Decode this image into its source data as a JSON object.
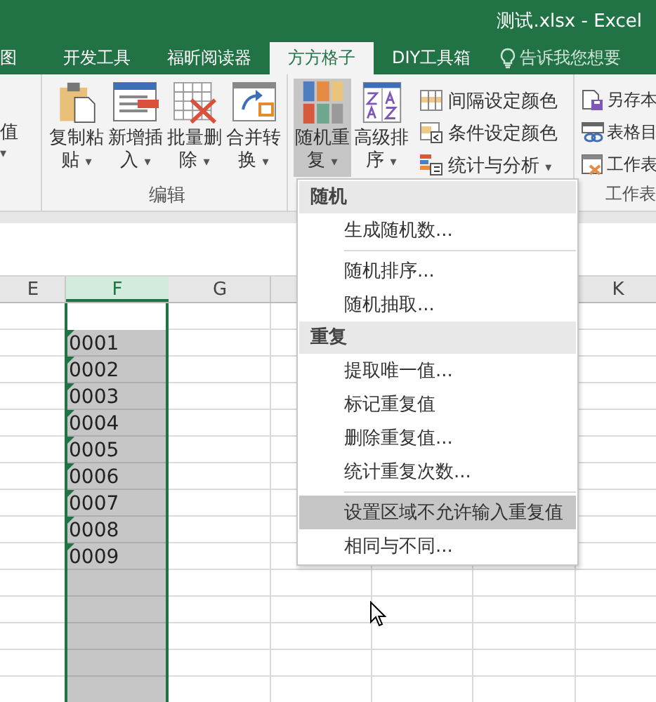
{
  "window": {
    "title": "测试.xlsx - Excel"
  },
  "tabs": [
    {
      "label": "图",
      "selected": false
    },
    {
      "label": "开发工具",
      "selected": false
    },
    {
      "label": "福昕阅读器",
      "selected": false
    },
    {
      "label": "方方格子",
      "selected": true
    },
    {
      "label": "DIY工具箱",
      "selected": false
    }
  ],
  "tell_me": {
    "placeholder": "告诉我您想要"
  },
  "ribbon": {
    "left_partial": {
      "label": "值",
      "caret": "▾"
    },
    "groups": [
      {
        "label": "编辑",
        "buttons": [
          {
            "kind": "big",
            "line1": "复制粘",
            "line2": "贴",
            "caret": "▾",
            "pressed": false
          },
          {
            "kind": "big",
            "line1": "新增插",
            "line2": "入",
            "caret": "▾",
            "pressed": false
          },
          {
            "kind": "big",
            "line1": "批量删",
            "line2": "除",
            "caret": "▾",
            "pressed": false
          },
          {
            "kind": "big",
            "line1": "合并转",
            "line2": "换",
            "caret": "▾",
            "pressed": false
          }
        ]
      },
      {
        "buttons": [
          {
            "kind": "big",
            "line1": "随机重",
            "line2": "复",
            "caret": "▾",
            "pressed": true
          },
          {
            "kind": "big",
            "line1": "高级排",
            "line2": "序",
            "caret": "▾",
            "pressed": false
          },
          {
            "kind": "stack",
            "items": [
              {
                "label": "间隔设定颜色"
              },
              {
                "label": "条件设定颜色"
              },
              {
                "label": "统计与分析",
                "caret": "▾"
              }
            ]
          }
        ]
      },
      {
        "label": "工作表",
        "buttons": [
          {
            "kind": "stack",
            "items": [
              {
                "label": "另存本"
              },
              {
                "label": "表格目"
              },
              {
                "label": "工作表"
              }
            ]
          }
        ]
      }
    ]
  },
  "sheet": {
    "columns": [
      {
        "label": "E",
        "selected": false
      },
      {
        "label": "F",
        "selected": true
      },
      {
        "label": "G",
        "selected": false
      },
      {
        "label": "K",
        "selected": false
      }
    ],
    "f_cells": [
      "0001",
      "0002",
      "0003",
      "0004",
      "0005",
      "0006",
      "0007",
      "0008",
      "0009"
    ]
  },
  "menu": [
    {
      "kind": "header",
      "label": "随机"
    },
    {
      "kind": "item",
      "label": "生成随机数...",
      "highlighted": false
    },
    {
      "kind": "separator"
    },
    {
      "kind": "item",
      "label": "随机排序...",
      "highlighted": false
    },
    {
      "kind": "item",
      "label": "随机抽取...",
      "highlighted": false
    },
    {
      "kind": "header",
      "label": "重复"
    },
    {
      "kind": "item",
      "label": "提取唯一值...",
      "highlighted": false
    },
    {
      "kind": "item",
      "label": "标记重复值",
      "highlighted": false
    },
    {
      "kind": "item",
      "label": "删除重复值...",
      "highlighted": false
    },
    {
      "kind": "item",
      "label": "统计重复次数...",
      "highlighted": false
    },
    {
      "kind": "separator"
    },
    {
      "kind": "item",
      "label": "设置区域不允许输入重复值",
      "highlighted": true
    },
    {
      "kind": "item",
      "label": "相同与不同...",
      "highlighted": false
    }
  ]
}
